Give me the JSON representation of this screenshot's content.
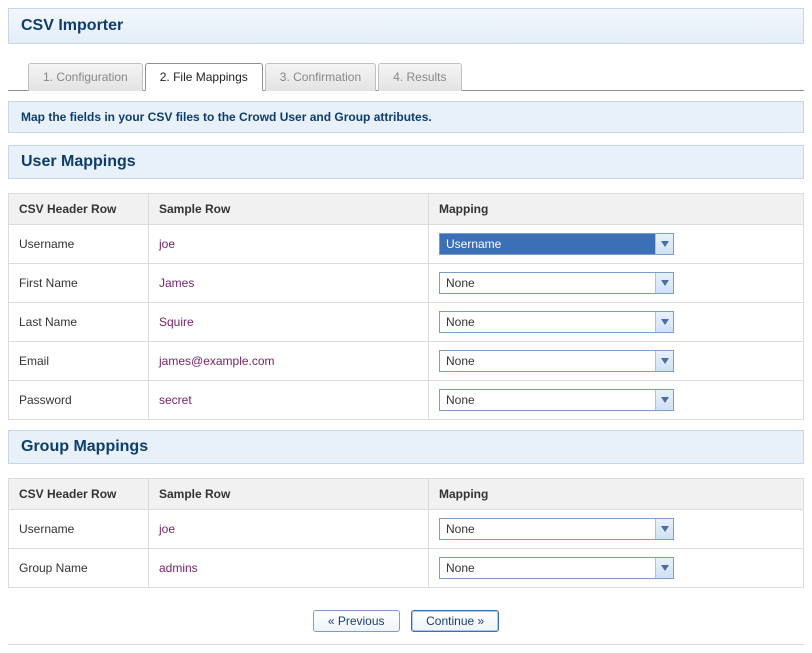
{
  "page_title": "CSV Importer",
  "tabs": [
    {
      "label": "1. Configuration",
      "active": false
    },
    {
      "label": "2. File Mappings",
      "active": true
    },
    {
      "label": "3. Confirmation",
      "active": false
    },
    {
      "label": "4. Results",
      "active": false
    }
  ],
  "info_text": "Map the fields in your CSV files to the Crowd User and Group attributes.",
  "sections": {
    "user": {
      "title": "User Mappings",
      "columns": [
        "CSV Header Row",
        "Sample Row",
        "Mapping"
      ],
      "rows": [
        {
          "header": "Username",
          "sample": "joe",
          "mapping": "Username",
          "highlight": true
        },
        {
          "header": "First Name",
          "sample": "James",
          "mapping": "None",
          "highlight": false
        },
        {
          "header": "Last Name",
          "sample": "Squire",
          "mapping": "None",
          "highlight": false
        },
        {
          "header": "Email",
          "sample": "james@example.com",
          "mapping": "None",
          "highlight": false
        },
        {
          "header": "Password",
          "sample": "secret",
          "mapping": "None",
          "highlight": false
        }
      ]
    },
    "group": {
      "title": "Group Mappings",
      "columns": [
        "CSV Header Row",
        "Sample Row",
        "Mapping"
      ],
      "rows": [
        {
          "header": "Username",
          "sample": "joe",
          "mapping": "None",
          "highlight": false
        },
        {
          "header": "Group Name",
          "sample": "admins",
          "mapping": "None",
          "highlight": false
        }
      ]
    }
  },
  "buttons": {
    "previous": "« Previous",
    "continue": "Continue »"
  }
}
